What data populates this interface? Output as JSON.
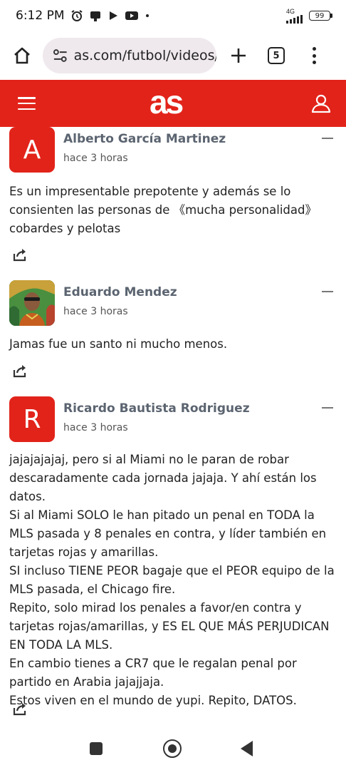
{
  "status_bar": {
    "time": "6:12 PM",
    "network": "4G",
    "battery": "99"
  },
  "browser": {
    "url": "as.com/futbol/videos/",
    "tab_count": "5"
  },
  "site": {
    "logo": "as",
    "brand_color": "#e2231a"
  },
  "comments": [
    {
      "avatar_letter": "A",
      "author": "Alberto García Martinez",
      "time": "hace 3 horas",
      "text": "Es un impresentable prepotente y además se lo consienten las personas de 《mucha personalidad》cobardes y pelotas"
    },
    {
      "avatar_letter": "",
      "author": "Eduardo Mendez",
      "time": "hace 3 horas",
      "text": "Jamas fue un santo ni mucho menos."
    },
    {
      "avatar_letter": "R",
      "author": "Ricardo Bautista Rodriguez",
      "time": "hace 3 horas",
      "text": "jajajajajaj, pero si al Miami no le paran de robar descaradamente cada jornada jajaja. Y ahí están los datos.\nSi al Miami SOLO le han pitado un penal en TODA la MLS pasada y 8 penales en contra, y líder también en tarjetas rojas y amarillas.\nSI incluso TIENE PEOR bagaje que el PEOR equipo de la MLS pasada, el Chicago fire.\nRepito, solo mirad los penales a favor/en contra y tarjetas rojas/amarillas, y ES EL QUE MÁS PERJUDICAN EN TODA LA MLS.\nEn cambio tienes a CR7 que le regalan penal por partido en Arabia jajajjaja.\nEstos viven en el mundo de yupi. Repito, DATOS."
    }
  ]
}
